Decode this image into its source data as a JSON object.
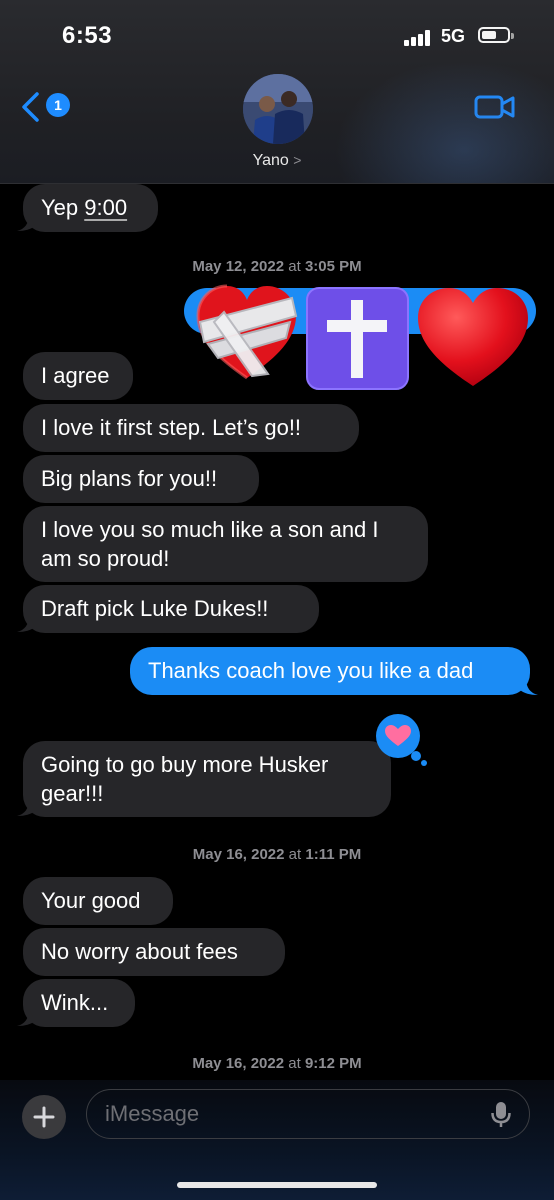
{
  "status_bar": {
    "time": "6:53",
    "network": "5G"
  },
  "header": {
    "back_badge": "1",
    "contact_name": "Yano",
    "chevron": ">"
  },
  "messages": [
    {
      "type": "in",
      "text_prefix": "Yep ",
      "text_link": "9:00"
    },
    {
      "type": "timestamp",
      "date": "May 12, 2022",
      "sep": " at ",
      "time": "3:05 PM"
    },
    {
      "type": "out",
      "emoji": [
        "mending-heart",
        "latin-cross",
        "red-heart"
      ]
    },
    {
      "type": "in",
      "text": "I agree"
    },
    {
      "type": "in",
      "text": "I love it first step. Let’s go!!"
    },
    {
      "type": "in",
      "text": "Big plans for you!!"
    },
    {
      "type": "in",
      "text": "I love you so much like a son and I am so proud!"
    },
    {
      "type": "in",
      "text": "Draft pick Luke Dukes!!"
    },
    {
      "type": "out",
      "text": "Thanks coach love you like a dad"
    },
    {
      "type": "in",
      "text": "Going to go buy more Husker gear!!!",
      "tapback": "heart"
    },
    {
      "type": "timestamp",
      "date": "May 16, 2022",
      "sep": " at ",
      "time": "1:11 PM"
    },
    {
      "type": "in",
      "text": "Your good"
    },
    {
      "type": "in",
      "text": "No worry about fees"
    },
    {
      "type": "in",
      "text": "Wink..."
    },
    {
      "type": "timestamp",
      "date": "May 16, 2022",
      "sep": " at ",
      "time": "9:12 PM"
    }
  ],
  "input": {
    "placeholder": "iMessage"
  },
  "colors": {
    "accent": "#1e8cff",
    "incoming_bubble": "#262629",
    "outgoing_bubble": "#1b8cf5",
    "tapback": "#ff6ea0"
  }
}
